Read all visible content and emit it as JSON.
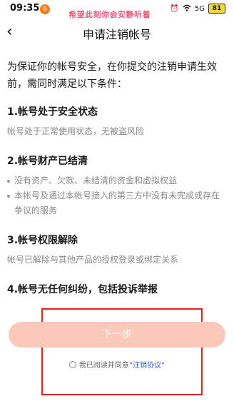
{
  "status_bar": {
    "time": "09:35",
    "app_badge": "6",
    "banner_text": "希望此刻你会安静听着",
    "signal_text": "5G",
    "battery": "81"
  },
  "header": {
    "back_icon": "‹",
    "title": "申请注销帐号"
  },
  "intro": "为保证你的帐号安全，在你提交的注销申请生效前，需同时满足以下条件：",
  "conditions": [
    {
      "title": "1.帐号处于安全状态",
      "body": "帐号处于正常使用状态，无被盗风险"
    },
    {
      "title": "2.帐号财产已结清",
      "bullets": [
        "没有资产、欠款、未结清的资金和虚拟权益",
        "本帐号及通过本帐号接入的第三方中没有未完成或存在争议的服务"
      ]
    },
    {
      "title": "3.帐号权限解除",
      "body": "帐号已解除与其他产品的授权登录或绑定关系"
    },
    {
      "title": "4.帐号无任何纠纷，包括投诉举报"
    }
  ],
  "footer": {
    "next_button": "下一步",
    "agree_prefix": "我已阅读并同意",
    "agree_link": "“注销协议”"
  },
  "colors": {
    "button_bg": "#fbc8ba",
    "link": "#2b5fd9",
    "highlight_box": "#e02020",
    "banner": "#e8567a"
  }
}
